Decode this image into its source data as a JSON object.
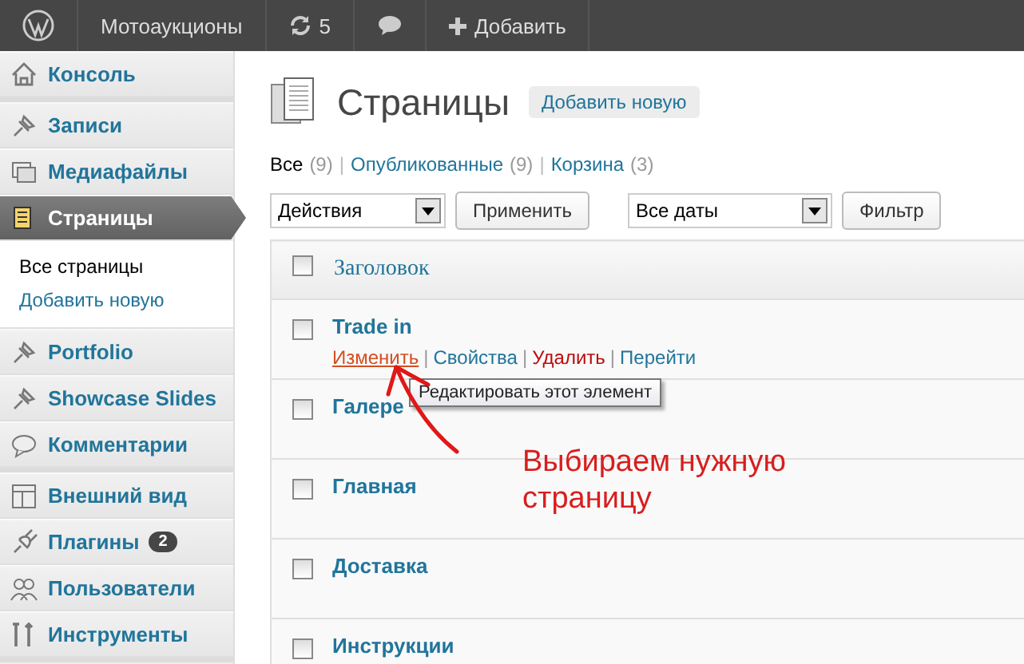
{
  "topbar": {
    "site": "Мотоаукционы",
    "updates": "5",
    "add": "Добавить"
  },
  "sidebar": {
    "groups": [
      [
        {
          "label": "Консоль",
          "selected": false
        }
      ],
      [
        {
          "label": "Записи",
          "selected": false
        },
        {
          "label": "Медиафайлы",
          "selected": false
        },
        {
          "label": "Страницы",
          "selected": true,
          "children": [
            {
              "label": "Все страницы",
              "selected": true
            },
            {
              "label": "Добавить новую",
              "selected": false
            }
          ]
        },
        {
          "label": "Portfolio",
          "selected": false
        },
        {
          "label": "Showcase Slides",
          "selected": false
        },
        {
          "label": "Комментарии",
          "selected": false
        }
      ],
      [
        {
          "label": "Внешний вид",
          "selected": false
        },
        {
          "label": "Плагины",
          "selected": false,
          "badge": "2"
        },
        {
          "label": "Пользователи",
          "selected": false
        },
        {
          "label": "Инструменты",
          "selected": false
        }
      ]
    ]
  },
  "page": {
    "title": "Страницы",
    "add_button": "Добавить новую"
  },
  "filters": [
    {
      "label": "Все",
      "count": "(9)",
      "selected": true
    },
    {
      "separator": "|",
      "label": "Опубликованные",
      "count": "(9)",
      "selected": false
    },
    {
      "separator": "|",
      "label": "Корзина",
      "count": "(3)",
      "selected": false
    }
  ],
  "toolbar": {
    "actions_select": "Действия",
    "apply": "Применить",
    "dates_select": "Все даты",
    "filter": "Фильтр"
  },
  "table": {
    "select_all_checked": false,
    "columns": [
      "Заголовок"
    ],
    "rows": [
      {
        "title": "Trade in",
        "checked": false,
        "actions": [
          {
            "label": "Изменить",
            "kind": "edit",
            "hovered": true
          },
          {
            "separator": "|",
            "label": "Свойства",
            "kind": "edit",
            "hovered": false
          },
          {
            "separator": "|",
            "label": "Удалить",
            "kind": "delete",
            "hovered": false
          },
          {
            "separator": "|",
            "label": "Перейти",
            "kind": "view",
            "hovered": false
          }
        ]
      },
      {
        "title": "Галере",
        "checked": false
      },
      {
        "title": "Главная",
        "checked": false
      },
      {
        "title": "Доставка",
        "checked": false
      },
      {
        "title": "Инструкции",
        "checked": false
      }
    ]
  },
  "tooltip": "Редактировать этот элемент",
  "annotation": "Выбираем нужную страницу"
}
